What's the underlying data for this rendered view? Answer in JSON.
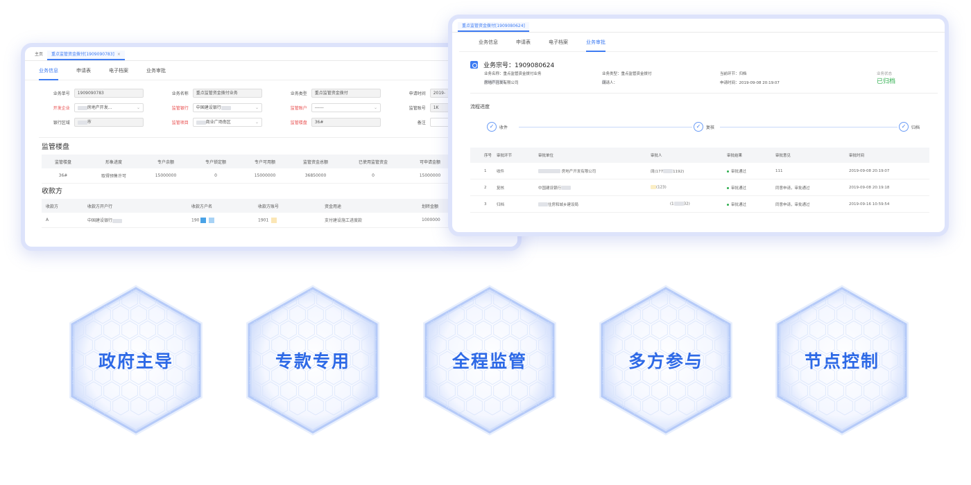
{
  "win1": {
    "tabs": [
      {
        "label": "主页"
      },
      {
        "label": "重点监管资金拨付[1909090783]",
        "close": "×"
      }
    ],
    "subtabs": [
      "业务信息",
      "申请表",
      "电子档案",
      "业务审批"
    ],
    "form": {
      "r1": [
        [
          "业务单号",
          "1909090783"
        ],
        [
          "业务名称",
          "重点监管资金拨付业务"
        ],
        [
          "业务类型",
          "重点监管资金拨付"
        ],
        [
          "申请时间",
          "2019-"
        ]
      ],
      "r2": [
        [
          "开发企业",
          "房地产开发..."
        ],
        [
          "监管银行",
          "中国建设银行"
        ],
        [
          "监管账户",
          "------"
        ],
        [
          "监管账号",
          "1K"
        ]
      ],
      "r3": [
        [
          "银行区域",
          "市"
        ],
        [
          "监管项目",
          "商业广场南区"
        ],
        [
          "监管楼盘",
          "36#"
        ],
        [
          "备注",
          ""
        ]
      ]
    },
    "sec1": "监管楼盘",
    "t1h": [
      "监管楼盘",
      "形象进度",
      "专户余额",
      "专户锁定额",
      "专户可用额",
      "监管资金总额",
      "已使用监管资金",
      "可申请金额"
    ],
    "t1r": [
      "36#",
      "取得预售许可",
      "15000000",
      "0",
      "15000000",
      "36850000",
      "0",
      "15000000"
    ],
    "sec2": "收款方",
    "t2h": [
      "收款方",
      "收款方开户行",
      "收款方户名",
      "收款方账号",
      "资金用途",
      "划转金额"
    ],
    "t2r": [
      "A",
      "中国建设银行",
      "190",
      "1901",
      "支付建设施工进度款",
      "1000000"
    ]
  },
  "win2": {
    "tab": "重点监管资金拨付[1909080624]",
    "subtabs": [
      "业务信息",
      "申请表",
      "电子档案",
      "业务审批"
    ],
    "biz_no": "业务宗号：1909080624",
    "info": {
      "a1": "业务名称：重点监管资金拨付业务",
      "a2": "业务类型：重点监管资金拨付",
      "a3": "当前环节：归档",
      "status_label": "业务状态",
      "b1": "申请单位：",
      "b1v": "房地产开发有限公司",
      "b2": "申请人：",
      "b2v": "阔",
      "b3": "申请时间：2019-09-08 20:19:07"
    },
    "status": "已归档",
    "flow_title": "流程进度",
    "flow": [
      "收件",
      "复核",
      "归档"
    ],
    "check": "✓",
    "th": [
      "序号",
      "审批环节",
      "审批单位",
      "审批人",
      "审批结果",
      "审批意见",
      "审批时间"
    ],
    "rows": [
      [
        "1",
        "收件",
        "房地产开发有限公司",
        "阔(177",
        "1192)",
        "审批通过",
        "111",
        "2019-09-08 20:19:07"
      ],
      [
        "2",
        "复核",
        "中国建设银行",
        "",
        "(123)",
        "审批通过",
        "同意申请，审批通过",
        "2019-09-08 20:19:18"
      ],
      [
        "3",
        "归档",
        "住房和城乡建设局",
        "(1",
        "32)",
        "审批通过",
        "同意申请，审批通过",
        "2019-09-16 10:59:54"
      ]
    ]
  },
  "features": [
    "政府主导",
    "专款专用",
    "全程监管",
    "多方参与",
    "节点控制"
  ]
}
